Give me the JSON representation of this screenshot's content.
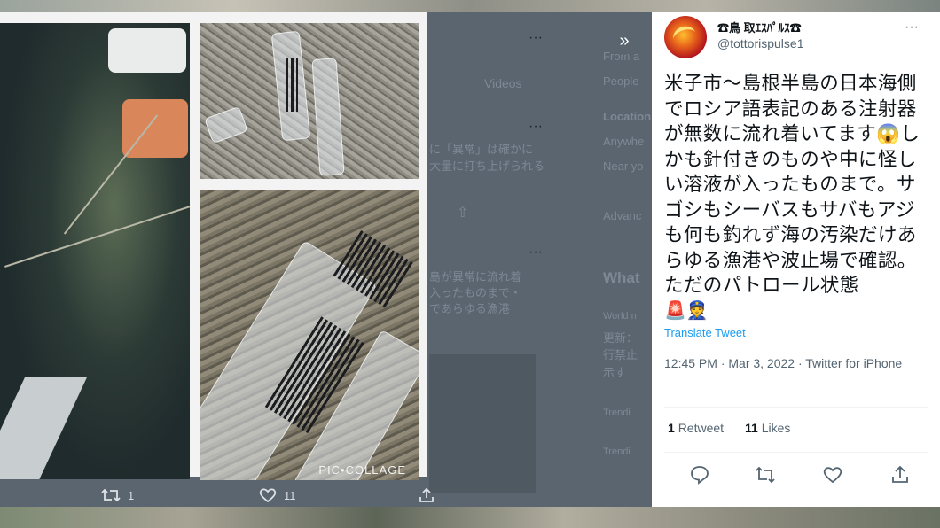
{
  "background_page": {
    "menu_dots": [
      "···",
      "···",
      "···"
    ],
    "videos_tab": "Videos",
    "sidebar_partial": [
      "From a",
      "People",
      "Location",
      "Anywhe",
      "Near yo",
      "Advanc"
    ],
    "whats_heading": "What",
    "trends_partial": [
      "World n",
      "更新：",
      "行禁止",
      "示す",
      "Trendi",
      "Trendi"
    ],
    "reply_snippets": [
      "に「異常」は確かに",
      "大量に打ち上げられる",
      "島が異常に流れ着",
      "入ったものまで・",
      "であらゆる漁港"
    ]
  },
  "image_tweet": {
    "collage_label": "PIC•COLLAGE",
    "retweet_count": "1",
    "like_count": "11"
  },
  "expand_icon": "»",
  "tweet": {
    "display_name": "☎鳥 取ｴｽﾊﾟﾙｽ☎",
    "handle": "@tottorispulse1",
    "more": "···",
    "text": "米子市～島根半島の日本海側でロシア語表記のある注射器が無数に流れ着いてます😱しかも針付きのものや中に怪しい溶液が入ったものまで。サゴシもシーバスもサバもアジも何も釣れず海の汚染だけあらゆる漁港や波止場で確認。ただのパトロール状態",
    "emojis": "🚨👮",
    "translate_label": "Translate Tweet",
    "timestamp": "12:45 PM · Mar 3, 2022 · Twitter for iPhone",
    "retweets_count": "1",
    "retweets_label": "Retweet",
    "likes_count": "11",
    "likes_label": "Likes"
  },
  "colors": {
    "link": "#1d9bf0",
    "text_primary": "#0f1419",
    "text_secondary": "#536471",
    "dimmed_overlay": "#5b6570"
  }
}
